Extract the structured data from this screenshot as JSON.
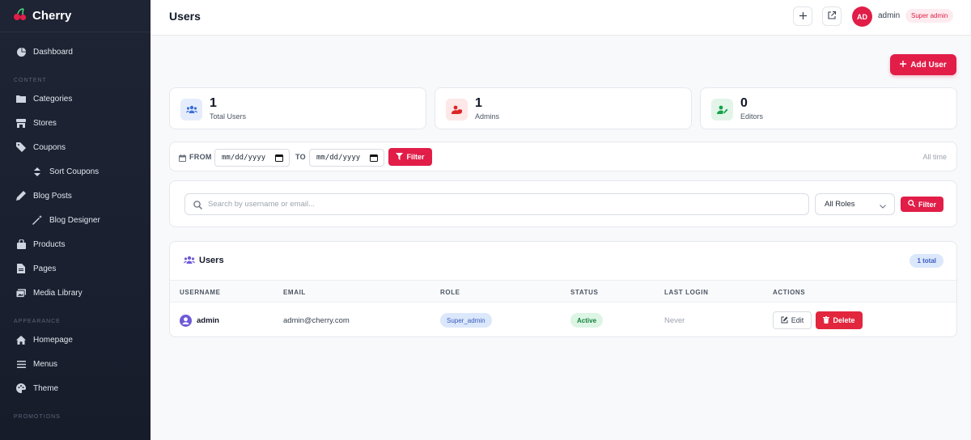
{
  "brand": {
    "name": "Cherry"
  },
  "sidebar": {
    "items": [
      {
        "label": "Dashboard",
        "icon": "dashboard-icon"
      },
      {
        "section": "CONTENT"
      },
      {
        "label": "Categories",
        "icon": "folder-icon"
      },
      {
        "label": "Stores",
        "icon": "store-icon"
      },
      {
        "label": "Coupons",
        "icon": "tag-icon"
      },
      {
        "label": "Sort Coupons",
        "icon": "sort-icon",
        "sub": true
      },
      {
        "label": "Blog Posts",
        "icon": "pen-icon"
      },
      {
        "label": "Blog Designer",
        "icon": "magic-wand-icon",
        "sub": true
      },
      {
        "label": "Products",
        "icon": "bag-icon"
      },
      {
        "label": "Pages",
        "icon": "file-icon"
      },
      {
        "label": "Media Library",
        "icon": "images-icon"
      },
      {
        "section": "APPEARANCE"
      },
      {
        "label": "Homepage",
        "icon": "home-icon"
      },
      {
        "label": "Menus",
        "icon": "menu-icon"
      },
      {
        "label": "Theme",
        "icon": "palette-icon"
      },
      {
        "section": "PROMOTIONS"
      }
    ]
  },
  "header": {
    "title": "Users",
    "avatar_initials": "AD",
    "user_name": "admin",
    "user_role": "Super admin"
  },
  "actions": {
    "add_user": "Add User"
  },
  "stats": [
    {
      "value": "1",
      "label": "Total Users",
      "icon": "users-icon",
      "color": "#3b6fd8"
    },
    {
      "value": "1",
      "label": "Admins",
      "icon": "user-shield-icon",
      "color": "#dc2626"
    },
    {
      "value": "0",
      "label": "Editors",
      "icon": "user-edit-icon",
      "color": "#16a34a"
    }
  ],
  "date_filter": {
    "from_label": "FROM",
    "to_label": "TO",
    "from_value": "mm/dd/yyyy",
    "to_value": "mm/dd/yyyy",
    "button": "Filter",
    "range": "All time"
  },
  "search": {
    "placeholder": "Search by username or email...",
    "role_selected": "All Roles",
    "button": "Filter"
  },
  "table": {
    "title": "Users",
    "total": "1 total",
    "columns": [
      "USERNAME",
      "EMAIL",
      "ROLE",
      "STATUS",
      "LAST LOGIN",
      "ACTIONS"
    ],
    "rows": [
      {
        "username": "admin",
        "email": "admin@cherry.com",
        "role": "Super_admin",
        "status": "Active",
        "last_login": "Never"
      }
    ],
    "edit_label": "Edit",
    "delete_label": "Delete"
  },
  "colors": {
    "accent": "#e11d48",
    "sidebar_bg": "#1e2433"
  }
}
